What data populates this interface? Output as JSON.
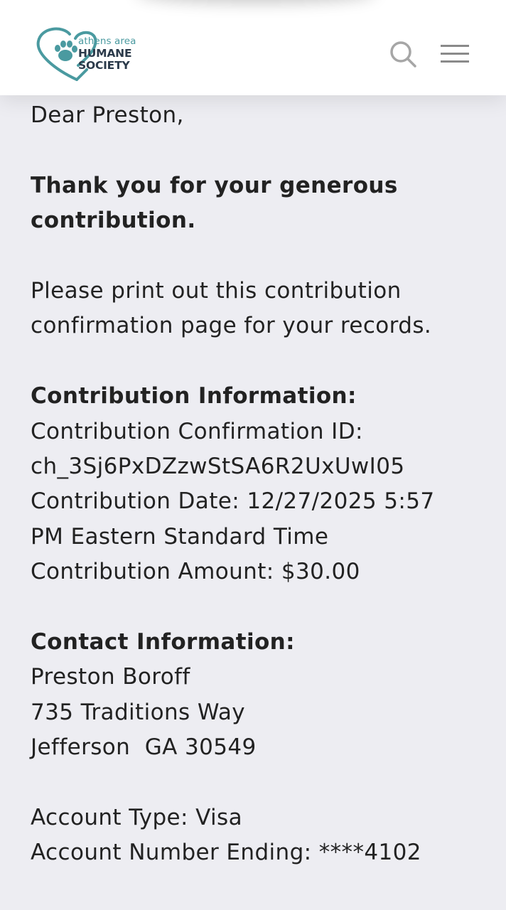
{
  "header": {
    "logo": {
      "line1": "athens area",
      "line2": "HUMANE",
      "line3": "SOCIETY",
      "heart_color": "#4a9aa0",
      "paw_color": "#4a9aa0"
    },
    "icons": {
      "search": "search-icon",
      "menu": "hamburger-menu-icon"
    }
  },
  "letter": {
    "greeting": "Dear Preston,",
    "thank_you_line1": "Thank you for your generous",
    "thank_you_line2": "contribution.",
    "print_line1": "Please print out this contribution",
    "print_line2": "confirmation page for your records.",
    "contribution_heading": "Contribution Information:",
    "confirmation_id_label": "Contribution Confirmation ID:",
    "confirmation_id_value": "ch_3Sj6PxDZzwStSA6R2UxUwI05",
    "date_line1": "Contribution Date: 12/27/2025 5:57",
    "date_line2": "PM Eastern Standard Time",
    "amount_line": "Contribution Amount: $30.00",
    "contact_heading": "Contact Information:",
    "contact_name": "Preston Boroff",
    "contact_street": "735 Traditions Way",
    "contact_city": "Jefferson  GA 30549",
    "account_type": "Account Type: Visa",
    "account_number": "Account Number Ending: ****4102"
  },
  "colors": {
    "background": "#ededf2",
    "header_bg": "#ffffff",
    "text": "#222222",
    "brand_teal": "#4a9aa0",
    "brand_dark": "#2b3a4a",
    "icon_gray": "#a6a6a6"
  }
}
